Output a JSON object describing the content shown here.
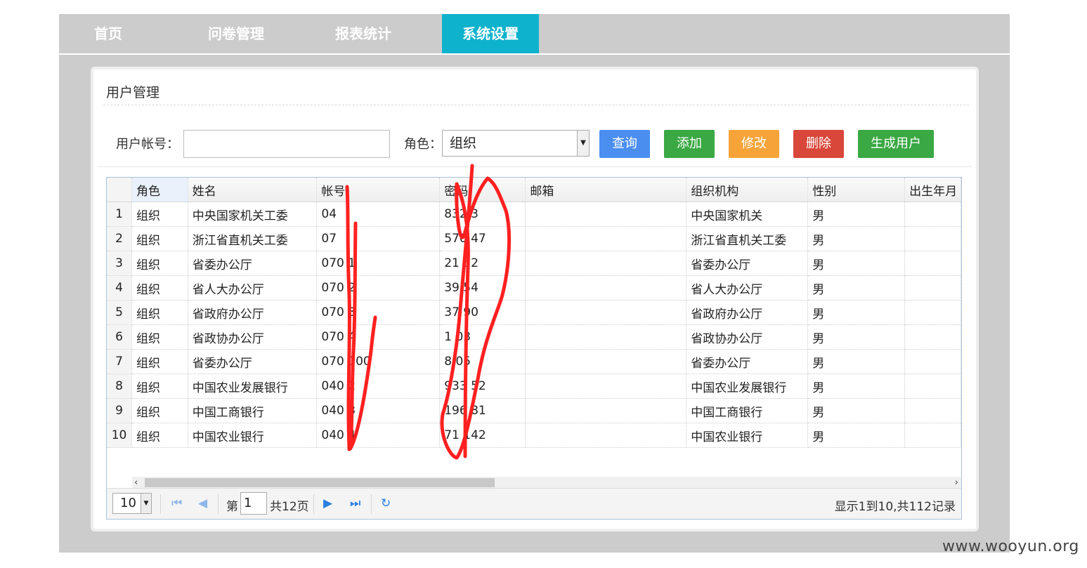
{
  "nav": {
    "tabs": [
      {
        "label": "首页"
      },
      {
        "label": "问卷管理"
      },
      {
        "label": "报表统计"
      },
      {
        "label": "系统设置",
        "active": true
      }
    ]
  },
  "panel": {
    "title": "用户管理"
  },
  "search": {
    "account_label": "用户帐号：",
    "account_value": "",
    "role_label": "角色：",
    "role_selected": "组织"
  },
  "buttons": {
    "query": "查询",
    "add": "添加",
    "edit": "修改",
    "delete": "删除",
    "generate": "生成用户"
  },
  "colors": {
    "query": "#4a8ef0",
    "add": "#3aa843",
    "edit": "#f6a43a",
    "delete": "#d9473a",
    "generate": "#3aa843",
    "active_tab": "#0fb2cc",
    "scribble": "#ff2020"
  },
  "table": {
    "columns": [
      "角色",
      "姓名",
      "帐号",
      "密码",
      "邮箱",
      "组织机构",
      "性别",
      "出生年月"
    ],
    "rows": [
      {
        "n": "1",
        "role": "组织",
        "name": "中央国家机关工委",
        "account": "04",
        "password": "832 3",
        "email": "",
        "org": "中央国家机关",
        "gender": "男"
      },
      {
        "n": "2",
        "role": "组织",
        "name": "浙江省直机关工委",
        "account": "07",
        "password": "570 47",
        "email": "",
        "org": "浙江省直机关工委",
        "gender": "男"
      },
      {
        "n": "3",
        "role": "组织",
        "name": "省委办公厅",
        "account": "070 1",
        "password": "21 52",
        "email": "",
        "org": "省委办公厅",
        "gender": "男"
      },
      {
        "n": "4",
        "role": "组织",
        "name": "省人大办公厅",
        "account": "070 2",
        "password": "39 54",
        "email": "",
        "org": "省人大办公厅",
        "gender": "男"
      },
      {
        "n": "5",
        "role": "组织",
        "name": "省政府办公厅",
        "account": "070 3",
        "password": "37 90",
        "email": "",
        "org": "省政府办公厅",
        "gender": "男"
      },
      {
        "n": "6",
        "role": "组织",
        "name": "省政协办公厅",
        "account": "070 4",
        "password": "1 03",
        "email": "",
        "org": "省政协办公厅",
        "gender": "男"
      },
      {
        "n": "7",
        "role": "组织",
        "name": "省委办公厅",
        "account": "070 100",
        "password": "8 05",
        "email": "",
        "org": "省委办公厅",
        "gender": "男"
      },
      {
        "n": "8",
        "role": "组织",
        "name": "中国农业发展银行",
        "account": "040 2",
        "password": "933 52",
        "email": "",
        "org": "中国农业发展银行",
        "gender": "男"
      },
      {
        "n": "9",
        "role": "组织",
        "name": "中国工商银行",
        "account": "040 3",
        "password": "196 81",
        "email": "",
        "org": "中国工商银行",
        "gender": "男"
      },
      {
        "n": "10",
        "role": "组织",
        "name": "中国农业银行",
        "account": "040 4",
        "password": "71 142",
        "email": "",
        "org": "中国农业银行",
        "gender": "男"
      }
    ]
  },
  "pager": {
    "page_size": "10",
    "page_prefix": "第",
    "page_current": "1",
    "page_total": "共12页",
    "info": "显示1到10,共112记录"
  },
  "watermark": "www.wooyun.org"
}
